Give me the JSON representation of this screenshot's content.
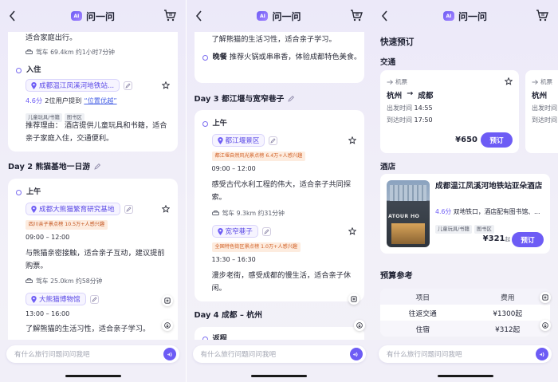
{
  "app": {
    "title": "问一问",
    "logo_text": "AI"
  },
  "input_placeholder": "有什么旅行问题问问我吧",
  "colors": {
    "accent": "#6d5cf5",
    "tag_bg": "#fdecdf",
    "tag_text": "#d2632a"
  },
  "panel1": {
    "top_text": "适合家庭出行。",
    "drive1": "驾车 69.4km 约1小时7分钟",
    "stay_label": "入住",
    "hotel_poi": "成都温江凤溪河地铁站...",
    "rating": "4.6分",
    "mention_prefix": "2位用户提到",
    "mention_link": "“位置优越”",
    "hotel_tags": [
      "儿童玩具/书籍",
      "图书区"
    ],
    "reason": "推荐理由：  酒店提供儿童玩具和书籍，适合亲子家庭入住，交通便利。",
    "day2_title": "Day 2 熊猫基地一日游",
    "morning": "上午",
    "poi_panda": "成都大熊猫繁育研究基地",
    "panda_tag": "四川亲子景点榜  10.5万+人感兴趣",
    "panda_time": "09:00 – 12:00",
    "panda_desc": "与熊猫亲密接触，适合亲子互动，建议提前购票。",
    "drive2": "驾车 25.0km 约58分钟",
    "poi_museum": "大熊猫博物馆",
    "museum_time": "13:00 – 16:00",
    "museum_desc": "了解熊猫的生活习性，适合亲子学习。"
  },
  "panel2": {
    "top_text": "了解熊猫的生活习性，适合亲子学习。",
    "dinner_label": "晚餐",
    "dinner_text": "推荐火锅或串串香，体验成都特色美食。",
    "day3_title": "Day 3 都江堰与宽窄巷子",
    "morning": "上午",
    "poi_dujiang": "都江堰景区",
    "dujiang_tag": "都江堰自然风光景点榜  6.4万+人感兴趣",
    "dujiang_time": "09:00 – 12:00",
    "dujiang_desc": "感受古代水利工程的伟大，适合亲子共同探索。",
    "drive": "驾车 9.3km 约31分钟",
    "poi_kuanzhai": "宽窄巷子",
    "kuanzhai_tag": "全国特色街区景点榜  1.0万+人感兴趣",
    "kuanzhai_time": "13:30 – 16:30",
    "kuanzhai_desc": "漫步老街，感受成都的慢生活，适合亲子休闲。",
    "day4_title": "Day 4 成都 – 杭州",
    "day4_partial": "返程"
  },
  "panel3": {
    "quick_title": "快速预订",
    "traffic_label": "交通",
    "flight": {
      "type": "机票",
      "route_from": "杭州",
      "arrow": "→",
      "route_to": "成都",
      "depart_label": "出发时间",
      "depart": "14:55",
      "arrive_label": "到达时间",
      "arrive": "17:50",
      "price": "¥650",
      "book": "预订"
    },
    "flight2": {
      "type": "机票",
      "route_from": "杭州"
    },
    "hotel_label": "酒店",
    "hotel": {
      "name": "成都温江凤溪河地铁站亚朵酒店",
      "rating": "4.6分",
      "desc": "双地铁口，酒店配有图书馆、...",
      "tags": [
        "儿童玩具/书籍",
        "图书区"
      ],
      "price": "¥321",
      "price_unit": "起",
      "book": "预订",
      "sign": "ATOUR HO"
    },
    "budget_label": "预算参考",
    "budget": {
      "headers": [
        "项目",
        "费用"
      ],
      "rows": [
        [
          "往返交通",
          "¥1300起"
        ],
        [
          "住宿",
          "¥312起"
        ]
      ]
    }
  }
}
